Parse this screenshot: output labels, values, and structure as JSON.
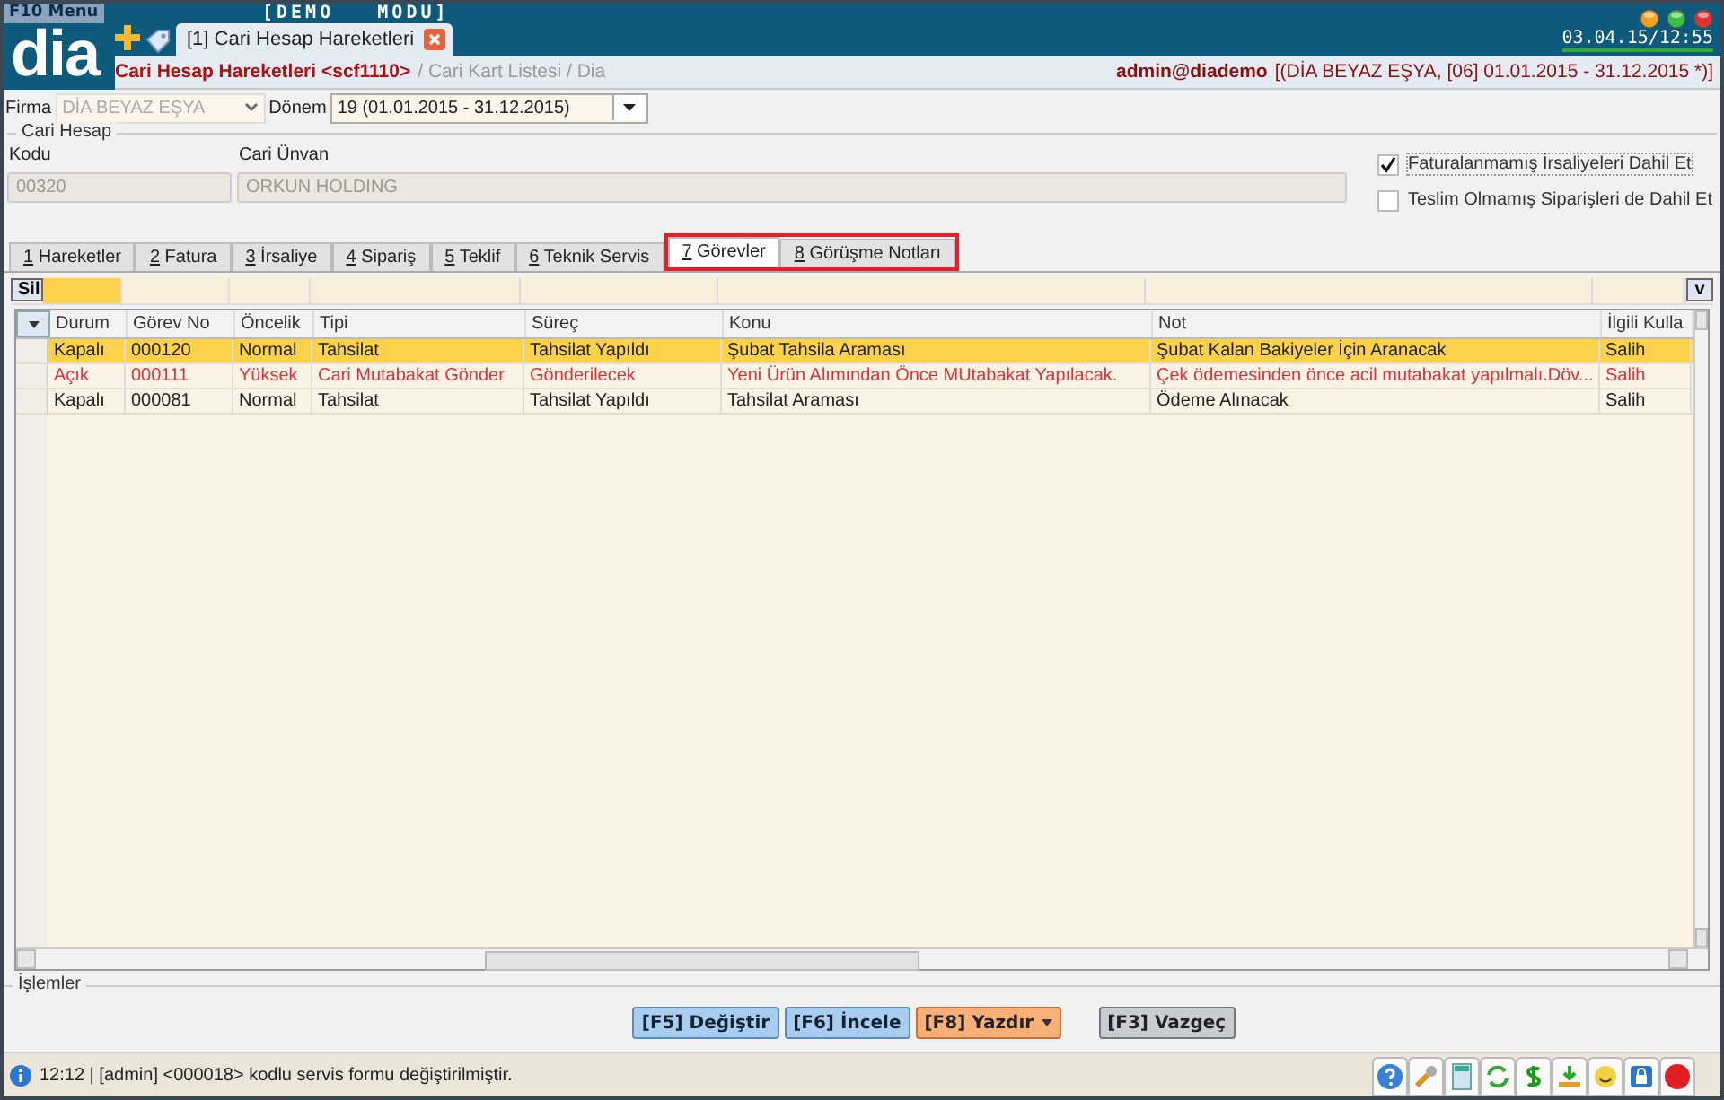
{
  "menu_label": "F10 Menu",
  "mode_label": "[DEMO   MODU]",
  "logo": "dia",
  "clock": "03.04.15/12:55",
  "open_tabs": [
    {
      "label": "[1] Cari Hesap Hareketleri",
      "selected": true
    }
  ],
  "breadcrumb": {
    "title": "Cari Hesap Hareketleri <scf1110>",
    "path": "/ Cari Kart Listesi / Dia",
    "user": "admin@diademo",
    "context": "[(DİA BEYAZ EŞYA, [06] 01.01.2015 - 31.12.2015 *)]"
  },
  "filters": {
    "firma_label": "Firma",
    "firma_value": "DİA BEYAZ EŞYA",
    "donem_label": "Dönem",
    "donem_value": "19 (01.01.2015 - 31.12.2015)"
  },
  "cari_hesap": {
    "title": "Cari Hesap",
    "kodu_label": "Kodu",
    "kodu": "00320",
    "unvan_label": "Cari Ünvan",
    "unvan": "ORKUN HOLDING",
    "options": [
      {
        "label": "Faturalanmamış İrsaliyeleri Dahil Et",
        "checked": true
      },
      {
        "label": "Teslim Olmamış Siparişleri de Dahil Et",
        "checked": false
      }
    ]
  },
  "tabs": [
    {
      "key": "1",
      "label": "Hareketler",
      "selected": false,
      "highlighted": false
    },
    {
      "key": "2",
      "label": "Fatura",
      "selected": false,
      "highlighted": false
    },
    {
      "key": "3",
      "label": "İrsaliye",
      "selected": false,
      "highlighted": false
    },
    {
      "key": "4",
      "label": "Sipariş",
      "selected": false,
      "highlighted": false
    },
    {
      "key": "5",
      "label": "Teklif",
      "selected": false,
      "highlighted": false
    },
    {
      "key": "6",
      "label": "Teknik Servis",
      "selected": false,
      "highlighted": false
    },
    {
      "key": "7",
      "label": "Görevler",
      "selected": true,
      "highlighted": true
    },
    {
      "key": "8",
      "label": "Görüşme Notları",
      "selected": false,
      "highlighted": true
    }
  ],
  "grid": {
    "delete_button": "Sil",
    "menu_button": "v",
    "columns": [
      "Durum",
      "Görev No",
      "Öncelik",
      "Tipi",
      "Süreç",
      "Konu",
      "Not",
      "İlgili Kulla"
    ],
    "rows": [
      {
        "cells": [
          "Kapalı",
          "000120",
          "Normal",
          "Tahsilat",
          "Tahsilat Yapıldı",
          "Şubat Tahsila Araması",
          "Şubat Kalan Bakiyeler İçin Aranacak",
          "Salih"
        ],
        "selected": true,
        "alert": false
      },
      {
        "cells": [
          "Açık",
          "000111",
          "Yüksek",
          "Cari Mutabakat Gönder",
          "Gönderilecek",
          "Yeni Ürün Alımından Önce MUtabakat Yapılacak.",
          "Çek ödemesinden önce acil mutabakat yapılmalı.Döv...",
          "Salih"
        ],
        "selected": false,
        "alert": true
      },
      {
        "cells": [
          "Kapalı",
          "000081",
          "Normal",
          "Tahsilat",
          "Tahsilat Yapıldı",
          "Tahsilat Araması",
          "Ödeme Alınacak",
          "Salih"
        ],
        "selected": false,
        "alert": false
      }
    ]
  },
  "actions": {
    "title": "İşlemler",
    "buttons": [
      {
        "label": "[F5] Değiştir",
        "kind": "primary"
      },
      {
        "label": "[F6] İncele",
        "kind": "primary"
      },
      {
        "label": "[F8] Yazdır",
        "kind": "dropdown"
      },
      {
        "label": "[F3] Vazgeç",
        "kind": "secondary"
      }
    ]
  },
  "status": {
    "message": "12:12 | [admin] <000018> kodlu servis formu değiştirilmiştir."
  }
}
